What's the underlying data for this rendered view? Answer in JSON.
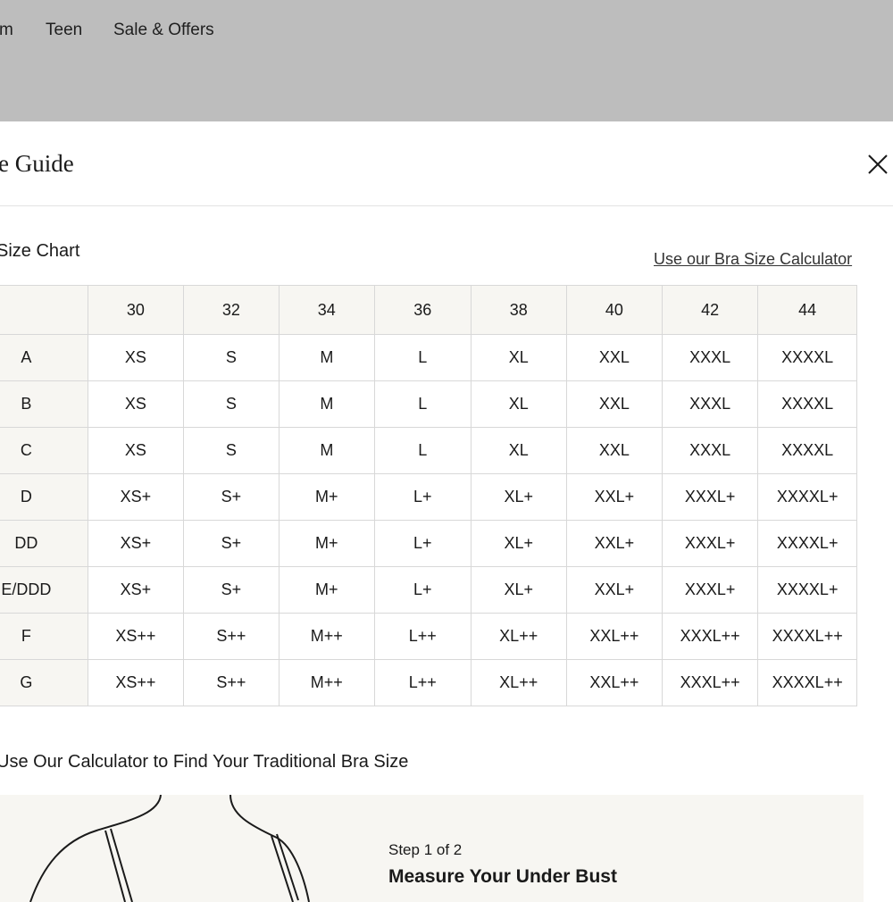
{
  "nav": {
    "items": [
      {
        "label": "m"
      },
      {
        "label": "Teen"
      },
      {
        "label": "Sale & Offers"
      }
    ]
  },
  "modal": {
    "title": "e Guide",
    "close_icon": "close-icon"
  },
  "size_chart": {
    "heading": "Size Chart",
    "calculator_link": "Use our Bra Size Calculator",
    "band_sizes": [
      "30",
      "32",
      "34",
      "36",
      "38",
      "40",
      "42",
      "44"
    ],
    "rows": [
      {
        "cup": "A",
        "sizes": [
          "XS",
          "S",
          "M",
          "L",
          "XL",
          "XXL",
          "XXXL",
          "XXXXL"
        ]
      },
      {
        "cup": "B",
        "sizes": [
          "XS",
          "S",
          "M",
          "L",
          "XL",
          "XXL",
          "XXXL",
          "XXXXL"
        ]
      },
      {
        "cup": "C",
        "sizes": [
          "XS",
          "S",
          "M",
          "L",
          "XL",
          "XXL",
          "XXXL",
          "XXXXL"
        ]
      },
      {
        "cup": "D",
        "sizes": [
          "XS+",
          "S+",
          "M+",
          "L+",
          "XL+",
          "XXL+",
          "XXXL+",
          "XXXXL+"
        ]
      },
      {
        "cup": "DD",
        "sizes": [
          "XS+",
          "S+",
          "M+",
          "L+",
          "XL+",
          "XXL+",
          "XXXL+",
          "XXXXL+"
        ]
      },
      {
        "cup": "E/DDD",
        "sizes": [
          "XS+",
          "S+",
          "M+",
          "L+",
          "XL+",
          "XXL+",
          "XXXL+",
          "XXXXL+"
        ]
      },
      {
        "cup": "F",
        "sizes": [
          "XS++",
          "S++",
          "M++",
          "L++",
          "XL++",
          "XXL++",
          "XXXL++",
          "XXXXL++"
        ]
      },
      {
        "cup": "G",
        "sizes": [
          "XS++",
          "S++",
          "M++",
          "L++",
          "XL++",
          "XXL++",
          "XXXL++",
          "XXXXL++"
        ]
      }
    ]
  },
  "calculator": {
    "heading": "Use Our Calculator to Find Your Traditional Bra Size",
    "step_label": "Step 1 of 2",
    "step_title": "Measure Your Under Bust",
    "illustration_icon": "torso-outline-icon"
  },
  "colors": {
    "overlay": "#bdbdbd",
    "header_cell_bg": "#f7f6f2",
    "border": "#d8d8d8",
    "panel_bg": "#f7f6f2"
  }
}
